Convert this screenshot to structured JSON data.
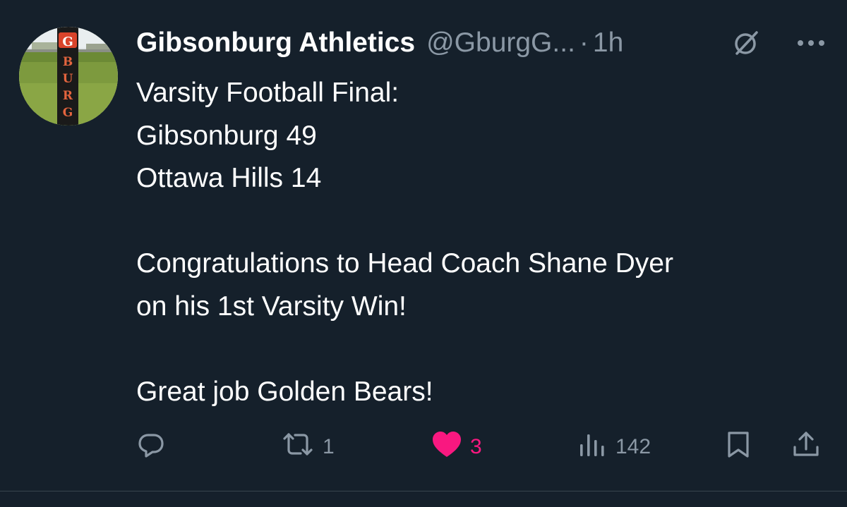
{
  "tweet": {
    "display_name": "Gibsonburg Athletics",
    "handle": "@GburgG...",
    "separator": "·",
    "time": "1h",
    "body_lines": [
      "Varsity Football Final:",
      "Gibsonburg 49",
      "Ottawa Hills 14",
      "",
      "Congratulations to Head Coach Shane Dyer",
      "on his 1st Varsity Win!",
      "",
      "Great job Golden Bears!"
    ],
    "avatar": {
      "post_letters": [
        "G",
        "B",
        "U",
        "R",
        "G"
      ]
    },
    "icons": {
      "grok": "grok-slash-icon",
      "more": "more-dots-icon",
      "reply": "reply-bubble-icon",
      "retweet": "retweet-icon",
      "like": "heart-filled-icon",
      "views": "bar-chart-icon",
      "bookmark": "bookmark-icon",
      "share": "share-upload-icon"
    },
    "metrics": {
      "retweets": "1",
      "likes": "3",
      "views": "142"
    },
    "colors": {
      "background": "#15202b",
      "text": "#ffffff",
      "secondary": "#8b98a5",
      "like_active": "#f91880",
      "divider": "#38444d"
    }
  }
}
